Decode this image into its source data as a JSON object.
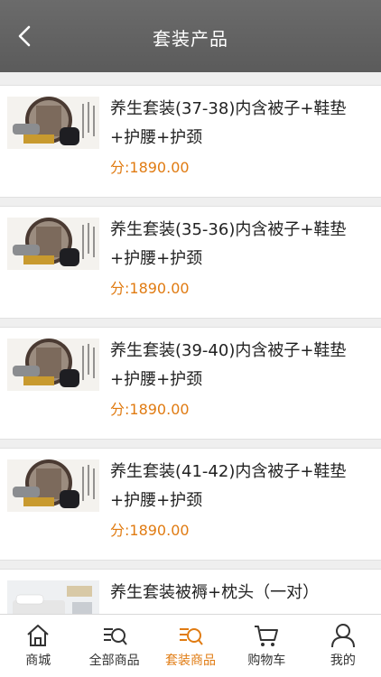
{
  "header": {
    "title": "套装产品"
  },
  "products": [
    {
      "name": "养生套装(37-38)内含被子+鞋垫+护腰+护颈",
      "price": "分:1890.00"
    },
    {
      "name": "养生套装(35-36)内含被子+鞋垫+护腰+护颈",
      "price": "分:1890.00"
    },
    {
      "name": "养生套装(39-40)内含被子+鞋垫+护腰+护颈",
      "price": "分:1890.00"
    },
    {
      "name": "养生套装(41-42)内含被子+鞋垫+护腰+护颈",
      "price": "分:1890.00"
    },
    {
      "name": "养生套装被褥+枕头（一对）",
      "price": ""
    }
  ],
  "tabbar": {
    "tabs": [
      {
        "label": "商城",
        "icon": "home-icon"
      },
      {
        "label": "全部商品",
        "icon": "search-list-icon"
      },
      {
        "label": "套装商品",
        "icon": "search-list-icon"
      },
      {
        "label": "购物车",
        "icon": "cart-icon"
      },
      {
        "label": "我的",
        "icon": "user-icon"
      }
    ],
    "active": 2,
    "active_color": "#e07b12"
  },
  "colors": {
    "header_bg": "#5f5f5f",
    "price": "#e07b12",
    "page_bg": "#efefef"
  }
}
